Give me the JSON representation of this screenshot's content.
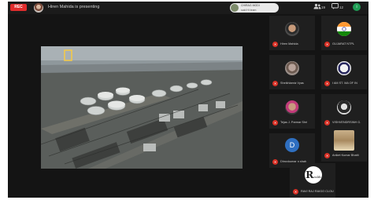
{
  "topbar": {
    "rec_label": "REC",
    "presenting_text": "Hiren Mahida is presenting",
    "notification": {
      "name": "CHIRAG MODI",
      "subtitle": "said Hi team"
    },
    "right_labels": [
      "19",
      "12"
    ]
  },
  "icons": {
    "participants": "people-icon",
    "chat": "chat-icon",
    "info": "info-icon"
  },
  "participants": [
    {
      "name": "Hiren Mahida",
      "type": "photo"
    },
    {
      "name": "GUJARAT NTPL",
      "type": "emblem"
    },
    {
      "name": "Sheikhlamiz Vyas",
      "type": "photo"
    },
    {
      "name": "I AM ST. MA OF IN",
      "type": "emblem"
    },
    {
      "name": "Tejas J. Parmar Shri",
      "type": "photo"
    },
    {
      "name": "VISHVENDRSINH G.",
      "type": "photo"
    },
    {
      "name": "Dhruvkumar n shah",
      "type": "letter",
      "letter": "D"
    },
    {
      "name": "Aniket Kumar Bhatti",
      "type": "photo"
    },
    {
      "name": "RAVI RAJ RAIGO CLOUDI",
      "type": "logo",
      "letter": "R",
      "sub": "raldi"
    }
  ],
  "colors": {
    "rec": "#e12d2d",
    "mic_muted": "#d93025",
    "avatar_blue": "#2f6fc0",
    "badge_green": "#1f9d55",
    "background": "#141414"
  }
}
